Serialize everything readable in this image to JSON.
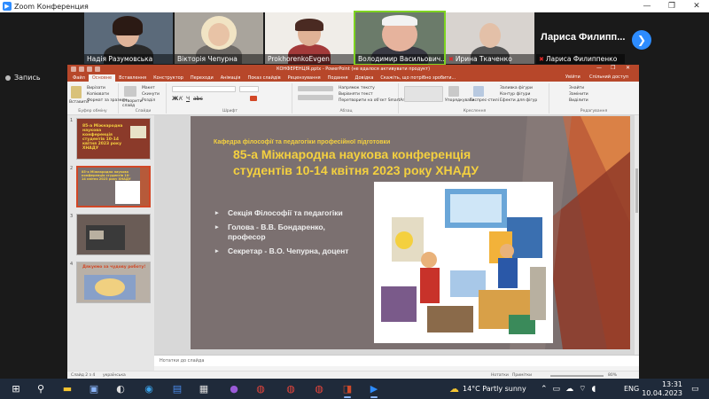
{
  "zoom": {
    "title": "Zoom Конференция",
    "window_controls": [
      "—",
      "❐",
      "✕"
    ],
    "participants": [
      {
        "name": "Надія Разумовська",
        "muted": false,
        "active": false
      },
      {
        "name": "Вікторія Чепурна",
        "muted": false,
        "active": false
      },
      {
        "name": "ProkhorenkoEvgen",
        "muted": false,
        "active": false
      },
      {
        "name": "Володимир Васильович...",
        "muted": false,
        "active": true
      },
      {
        "name": "Ирина Ткаченко",
        "muted": true,
        "active": false
      },
      {
        "name": "Лариса Филиппенко",
        "muted": true,
        "active": false
      }
    ],
    "featured_name": "Лариса  Филипп...",
    "next_icon": "chevron-right-icon",
    "record_label": "Запись"
  },
  "ppt": {
    "window_title": "КОНФЕРЕНЦІЯ.pptx - PowerPoint (не вдалося активувати продукт)",
    "tabs": [
      "Файл",
      "Основне",
      "Вставлення",
      "Конструктор",
      "Переходи",
      "Анімація",
      "Показ слайдів",
      "Рецензування",
      "Подання",
      "Довідка"
    ],
    "active_tab": 1,
    "tell_me": "Скажіть, що потрібно зробити...",
    "signin": "Увійти",
    "share": "Спільний доступ",
    "ribbon_groups": [
      "Буфер обміну",
      "Слайди",
      "Шрифт",
      "Абзац",
      "Креслення",
      "Редагування"
    ],
    "ribbon_items": {
      "paste": "Вставити",
      "cut": "Вирізати",
      "copy": "Копіювати",
      "format_painter": "Формат за зразком",
      "new_slide": "Створити слайд",
      "layout": "Макет",
      "reset": "Скинути",
      "section": "Розділ",
      "text_direction": "Напрямок тексту",
      "align_text": "Вирівняти текст",
      "smartart": "Перетворити на об'єкт SmartArt",
      "arrange": "Упорядкувати",
      "quick_styles": "Експрес-стилі",
      "shape_fill": "Заливка фігури",
      "shape_outline": "Контур фігури",
      "shape_effects": "Ефекти для фігур",
      "find": "Знайти",
      "replace": "Замінити",
      "select": "Виділити"
    },
    "notes_placeholder": "Нотатки до слайда",
    "status_slide": "Слайд 2 з 4",
    "status_lang": "українська",
    "status_notes": "Нотатки",
    "status_comments": "Примітки",
    "zoom_percent": "80%",
    "thumbnails": [
      {
        "num": "1",
        "text": "85-а Міжнародна наукова конференція студентів 10-14 квітня 2023 року ХНАДУ"
      },
      {
        "num": "2",
        "text": "85-а Міжнародна наукова конференція студентів 10-14 квітня 2023 року ХНАДУ"
      },
      {
        "num": "3",
        "text": ""
      },
      {
        "num": "4",
        "text": "Дякуємо за чудову роботу!"
      }
    ]
  },
  "slide": {
    "subtitle": "Кафедра філософії та педагогіки професійної підготовки",
    "title": "85-а Міжнародна наукова конференція студентів 10-14 квітня 2023 року ХНАДУ",
    "bullets": [
      "Секція Філософії та педагогіки",
      "Голова - В.В. Бондаренко, професор",
      "Секретар - В.О. Чепурна, доцент"
    ]
  },
  "taskbar": {
    "weather": "14°C  Partly sunny",
    "language": "ENG",
    "time": "13:31",
    "date": "10.04.2023"
  },
  "colors": {
    "ppt_accent": "#b7472a",
    "slide_bg": "#7b7070",
    "slide_title": "#f4d03f",
    "zoom_blue": "#2d8cff",
    "taskbar": "#1f2a3a"
  }
}
